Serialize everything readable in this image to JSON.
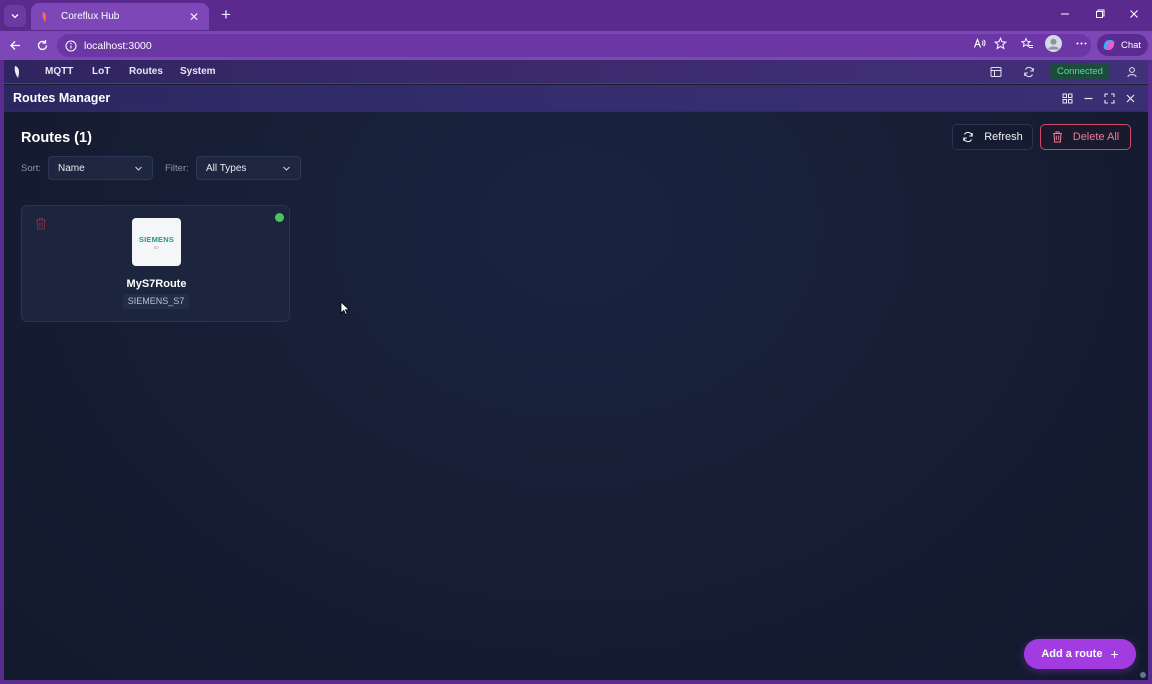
{
  "browser": {
    "tab_title": "Coreflux Hub",
    "url": "localhost:3000",
    "chat_label": "Chat"
  },
  "app": {
    "nav": {
      "items": [
        {
          "label": "MQTT"
        },
        {
          "label": "LoT"
        },
        {
          "label": "Routes"
        },
        {
          "label": "System"
        }
      ],
      "status": "Connected"
    },
    "panel": {
      "title": "Routes Manager"
    },
    "routes": {
      "heading": "Routes (1)",
      "refresh_label": "Refresh",
      "delete_all_label": "Delete All",
      "sort_label": "Sort:",
      "sort_value": "Name",
      "filter_label": "Filter:",
      "filter_value": "All Types",
      "cards": [
        {
          "name": "MyS7Route",
          "type": "SIEMENS_S7",
          "logo_text": "SIEMENS",
          "logo_sub": "S7",
          "status": "online"
        }
      ],
      "add_label": "Add a route",
      "add_icon": "+"
    }
  },
  "colors": {
    "accent": "#a23be0",
    "status_online": "#46c75a",
    "danger": "#d2476a",
    "connected": "#4ee089"
  }
}
